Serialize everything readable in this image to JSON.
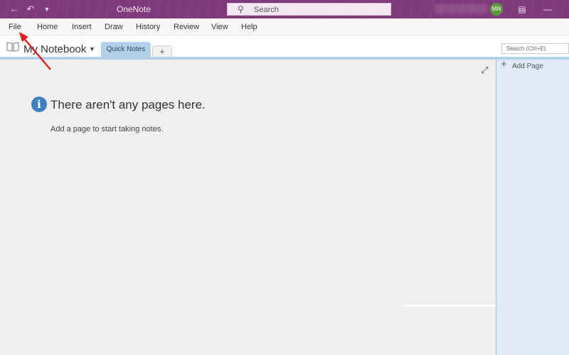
{
  "titlebar": {
    "app_title": "OneNote",
    "search_placeholder": "Search",
    "avatar_initials": "MN",
    "accent_color": "#80397b"
  },
  "menu": {
    "items": [
      "File",
      "Home",
      "Insert",
      "Draw",
      "History",
      "Review",
      "View",
      "Help"
    ]
  },
  "notebook": {
    "name": "My Notebook",
    "section_tab": "Quick Notes",
    "add_section": "+",
    "page_search_placeholder": "Search (Ctrl+E)"
  },
  "canvas": {
    "empty_title": "There aren't any pages here.",
    "empty_subtitle": "Add a page to start taking notes.",
    "info_glyph": "i"
  },
  "pagelist": {
    "add_page_label": "Add Page",
    "add_page_glyph": "+"
  },
  "annotation": {
    "arrow_color": "#e02020",
    "points_to": "File"
  }
}
